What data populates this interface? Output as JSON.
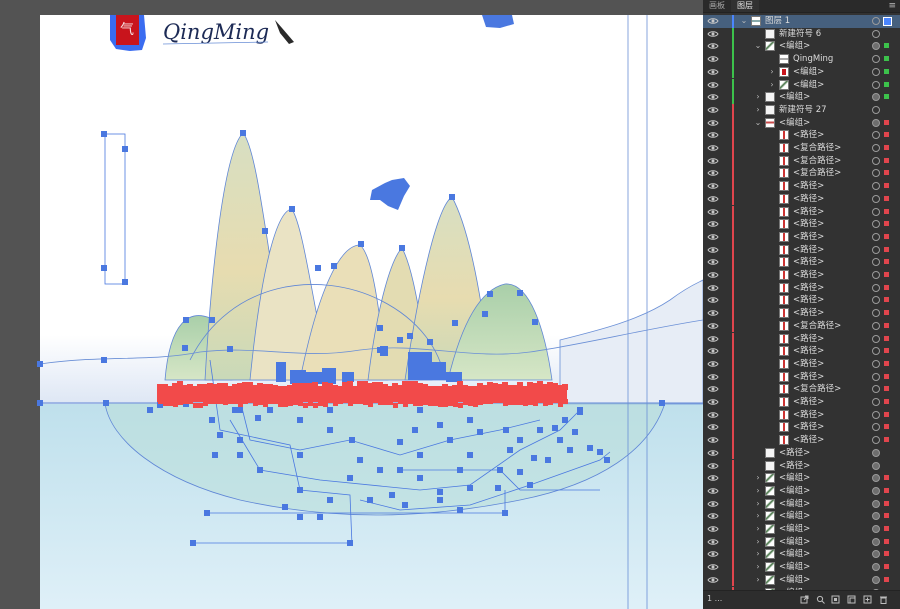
{
  "artboard": {
    "logo_char": "气",
    "title": "QingMing"
  },
  "panel": {
    "tabs": [
      "画板",
      "图层"
    ],
    "active_tab": "图层",
    "menu_glyph": "≡",
    "footer_count": "1 ...",
    "colors": {
      "blue": "#4b86ff",
      "green": "#3cc24b",
      "red": "#e0454d",
      "selection_bg": "#46607e"
    },
    "layers": [
      {
        "name": "图层 1",
        "indent": 0,
        "chevron": "open",
        "thumb": "layer",
        "bar": "blue",
        "sel": "blue",
        "selected": true
      },
      {
        "name": "新建符号 6",
        "indent": 1,
        "chevron": "none",
        "thumb": "blank",
        "bar": "green",
        "sel": "none"
      },
      {
        "name": "<编组>",
        "indent": 1,
        "chevron": "open",
        "thumb": "group",
        "bar": "green",
        "sel": "green",
        "target_filled": true
      },
      {
        "name": "QingMing",
        "indent": 2,
        "chevron": "none",
        "thumb": "text",
        "bar": "green",
        "sel": "green"
      },
      {
        "name": "<编组>",
        "indent": 2,
        "chevron": "closed",
        "thumb": "redseal",
        "bar": "green",
        "sel": "green"
      },
      {
        "name": "<编组>",
        "indent": 2,
        "chevron": "closed",
        "thumb": "group",
        "bar": "green",
        "sel": "green"
      },
      {
        "name": "<编组>",
        "indent": 1,
        "chevron": "closed",
        "thumb": "blank",
        "bar": "green",
        "sel": "green",
        "target_filled": true
      },
      {
        "name": "新建符号 27",
        "indent": 1,
        "chevron": "closed",
        "thumb": "blank",
        "bar": "red",
        "sel": "none"
      },
      {
        "name": "<编组>",
        "indent": 1,
        "chevron": "open",
        "thumb": "mountain",
        "bar": "red",
        "sel": "red",
        "target_filled": true
      },
      {
        "name": "<路径>",
        "indent": 2,
        "chevron": "none",
        "thumb": "path",
        "bar": "red",
        "sel": "red"
      },
      {
        "name": "<复合路径>",
        "indent": 2,
        "chevron": "none",
        "thumb": "path",
        "bar": "red",
        "sel": "red"
      },
      {
        "name": "<复合路径>",
        "indent": 2,
        "chevron": "none",
        "thumb": "path",
        "bar": "red",
        "sel": "red"
      },
      {
        "name": "<复合路径>",
        "indent": 2,
        "chevron": "none",
        "thumb": "path",
        "bar": "red",
        "sel": "red"
      },
      {
        "name": "<路径>",
        "indent": 2,
        "chevron": "none",
        "thumb": "path",
        "bar": "red",
        "sel": "red"
      },
      {
        "name": "<路径>",
        "indent": 2,
        "chevron": "none",
        "thumb": "path",
        "bar": "red",
        "sel": "red"
      },
      {
        "name": "<路径>",
        "indent": 2,
        "chevron": "none",
        "thumb": "path",
        "bar": "red",
        "sel": "red"
      },
      {
        "name": "<路径>",
        "indent": 2,
        "chevron": "none",
        "thumb": "path",
        "bar": "red",
        "sel": "red"
      },
      {
        "name": "<路径>",
        "indent": 2,
        "chevron": "none",
        "thumb": "path",
        "bar": "red",
        "sel": "red"
      },
      {
        "name": "<路径>",
        "indent": 2,
        "chevron": "none",
        "thumb": "path",
        "bar": "red",
        "sel": "red"
      },
      {
        "name": "<路径>",
        "indent": 2,
        "chevron": "none",
        "thumb": "path",
        "bar": "red",
        "sel": "red"
      },
      {
        "name": "<路径>",
        "indent": 2,
        "chevron": "none",
        "thumb": "path",
        "bar": "red",
        "sel": "red"
      },
      {
        "name": "<路径>",
        "indent": 2,
        "chevron": "none",
        "thumb": "path",
        "bar": "red",
        "sel": "red"
      },
      {
        "name": "<路径>",
        "indent": 2,
        "chevron": "none",
        "thumb": "path",
        "bar": "red",
        "sel": "red"
      },
      {
        "name": "<路径>",
        "indent": 2,
        "chevron": "none",
        "thumb": "path",
        "bar": "red",
        "sel": "red"
      },
      {
        "name": "<复合路径>",
        "indent": 2,
        "chevron": "none",
        "thumb": "path",
        "bar": "red",
        "sel": "red"
      },
      {
        "name": "<路径>",
        "indent": 2,
        "chevron": "none",
        "thumb": "path",
        "bar": "red",
        "sel": "red"
      },
      {
        "name": "<路径>",
        "indent": 2,
        "chevron": "none",
        "thumb": "path",
        "bar": "red",
        "sel": "red"
      },
      {
        "name": "<路径>",
        "indent": 2,
        "chevron": "none",
        "thumb": "path",
        "bar": "red",
        "sel": "red"
      },
      {
        "name": "<路径>",
        "indent": 2,
        "chevron": "none",
        "thumb": "path",
        "bar": "red",
        "sel": "red"
      },
      {
        "name": "<复合路径>",
        "indent": 2,
        "chevron": "none",
        "thumb": "path",
        "bar": "red",
        "sel": "red"
      },
      {
        "name": "<路径>",
        "indent": 2,
        "chevron": "none",
        "thumb": "path",
        "bar": "red",
        "sel": "red"
      },
      {
        "name": "<路径>",
        "indent": 2,
        "chevron": "none",
        "thumb": "path",
        "bar": "red",
        "sel": "red"
      },
      {
        "name": "<路径>",
        "indent": 2,
        "chevron": "none",
        "thumb": "path",
        "bar": "red",
        "sel": "red"
      },
      {
        "name": "<路径>",
        "indent": 2,
        "chevron": "none",
        "thumb": "path",
        "bar": "red",
        "sel": "red"
      },
      {
        "name": "<路径>",
        "indent": 1,
        "chevron": "none",
        "thumb": "blank",
        "bar": "red",
        "sel": "none",
        "target_filled": true
      },
      {
        "name": "<路径>",
        "indent": 1,
        "chevron": "none",
        "thumb": "blank",
        "bar": "red",
        "sel": "none",
        "target_filled": true
      },
      {
        "name": "<编组>",
        "indent": 1,
        "chevron": "closed",
        "thumb": "group",
        "bar": "red",
        "sel": "red",
        "target_filled": true
      },
      {
        "name": "<编组>",
        "indent": 1,
        "chevron": "closed",
        "thumb": "group",
        "bar": "red",
        "sel": "red",
        "target_filled": true
      },
      {
        "name": "<编组>",
        "indent": 1,
        "chevron": "closed",
        "thumb": "group",
        "bar": "red",
        "sel": "red",
        "target_filled": true
      },
      {
        "name": "<编组>",
        "indent": 1,
        "chevron": "closed",
        "thumb": "group",
        "bar": "red",
        "sel": "red",
        "target_filled": true
      },
      {
        "name": "<编组>",
        "indent": 1,
        "chevron": "closed",
        "thumb": "group",
        "bar": "red",
        "sel": "red",
        "target_filled": true
      },
      {
        "name": "<编组>",
        "indent": 1,
        "chevron": "closed",
        "thumb": "group",
        "bar": "red",
        "sel": "red",
        "target_filled": true
      },
      {
        "name": "<编组>",
        "indent": 1,
        "chevron": "closed",
        "thumb": "group",
        "bar": "red",
        "sel": "red",
        "target_filled": true
      },
      {
        "name": "<编组>",
        "indent": 1,
        "chevron": "closed",
        "thumb": "group",
        "bar": "red",
        "sel": "red",
        "target_filled": true
      },
      {
        "name": "<编组>",
        "indent": 1,
        "chevron": "closed",
        "thumb": "group",
        "bar": "red",
        "sel": "red",
        "target_filled": true
      },
      {
        "name": "<编组>",
        "indent": 1,
        "chevron": "closed",
        "thumb": "group",
        "bar": "red",
        "sel": "red",
        "target_filled": true
      }
    ]
  }
}
